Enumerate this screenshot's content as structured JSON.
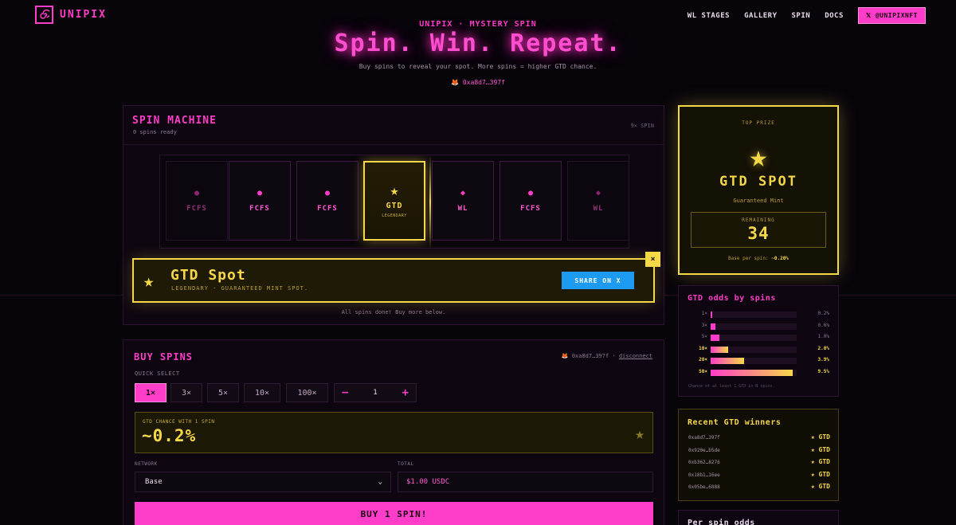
{
  "header": {
    "logo_text": "UNIPIX",
    "logo_icon": "spiral-icon",
    "nav": [
      "WL STAGES",
      "GALLERY",
      "SPIN",
      "DOCS"
    ],
    "x_handle": "@UNIPIXNFT"
  },
  "hero": {
    "kicker": "UNIPIX · MYSTERY SPIN",
    "title": "Spin. Win. Repeat.",
    "subtitle": "Buy spins to reveal your spot. More spins = higher GTD chance.",
    "wallet": "0xa8d7…397f"
  },
  "machine": {
    "title": "SPIN MACHINE",
    "status": "0 spins ready",
    "badge": "9× SPIN",
    "cards": [
      {
        "label": "FCFS",
        "symbol": "●"
      },
      {
        "label": "FCFS",
        "symbol": "●"
      },
      {
        "label": "FCFS",
        "symbol": "●"
      },
      {
        "label": "GTD",
        "symbol": "★",
        "rarity": "LEGENDARY"
      },
      {
        "label": "WL",
        "symbol": "◆"
      },
      {
        "label": "FCFS",
        "symbol": "●"
      },
      {
        "label": "WL",
        "symbol": "◆"
      }
    ],
    "result": {
      "title": "GTD Spot",
      "subtitle": "LEGENDARY · GUARANTEED MINT SPOT.",
      "share_label": "SHARE ON X",
      "close": "×"
    },
    "done_text": "All spins done! Buy more below."
  },
  "buy": {
    "title": "BUY SPINS",
    "wallet": "0xa8d7…397f",
    "disconnect": "disconnect",
    "quick_select_label": "QUICK SELECT",
    "quick_options": [
      "1×",
      "3×",
      "5×",
      "10×",
      "100×"
    ],
    "stepper": {
      "minus": "−",
      "value": "1",
      "plus": "+"
    },
    "chance_label": "GTD CHANCE WITH 1 SPIN",
    "chance_value": "~0.2%",
    "network_label": "NETWORK",
    "network_value": "Base",
    "total_label": "TOTAL",
    "total_value": "$1.00 USDC",
    "buy_label": "BUY 1 SPIN!"
  },
  "prize": {
    "top": "TOP PRIZE",
    "title": "GTD SPOT",
    "subtitle": "Guaranteed Mint",
    "remaining_label": "REMAINING",
    "remaining_value": "34",
    "base_label": "Base per spin:",
    "base_value": "~0.20%"
  },
  "odds": {
    "title": "GTD odds by spins",
    "rows": [
      {
        "spins": "1×",
        "value": "0.2%",
        "pct": 0.2,
        "hl": false
      },
      {
        "spins": "3×",
        "value": "0.6%",
        "pct": 0.6,
        "hl": false
      },
      {
        "spins": "5×",
        "value": "1.0%",
        "pct": 1.0,
        "hl": false
      },
      {
        "spins": "10×",
        "value": "2.0%",
        "pct": 2.0,
        "hl": true
      },
      {
        "spins": "20×",
        "value": "3.9%",
        "pct": 3.9,
        "hl": true
      },
      {
        "spins": "50×",
        "value": "9.5%",
        "pct": 9.5,
        "hl": true
      }
    ],
    "note": "Chance of at least 1 GTD in N spins."
  },
  "winners": {
    "title": "Recent GTD winners",
    "rows": [
      {
        "addr": "0xa8d7…397f",
        "tag": "★ GTD"
      },
      {
        "addr": "0x920e…b5de",
        "tag": "★ GTD"
      },
      {
        "addr": "0xb362…8276",
        "tag": "★ GTD"
      },
      {
        "addr": "0x18b1…16ee",
        "tag": "★ GTD"
      },
      {
        "addr": "0x05be…6888",
        "tag": "★ GTD"
      }
    ]
  },
  "perspin": {
    "title": "Per spin odds"
  },
  "colors": {
    "accent": "#ff3dc8",
    "gold": "#f5d847",
    "share": "#1d9bf0",
    "bg": "#07040a"
  }
}
